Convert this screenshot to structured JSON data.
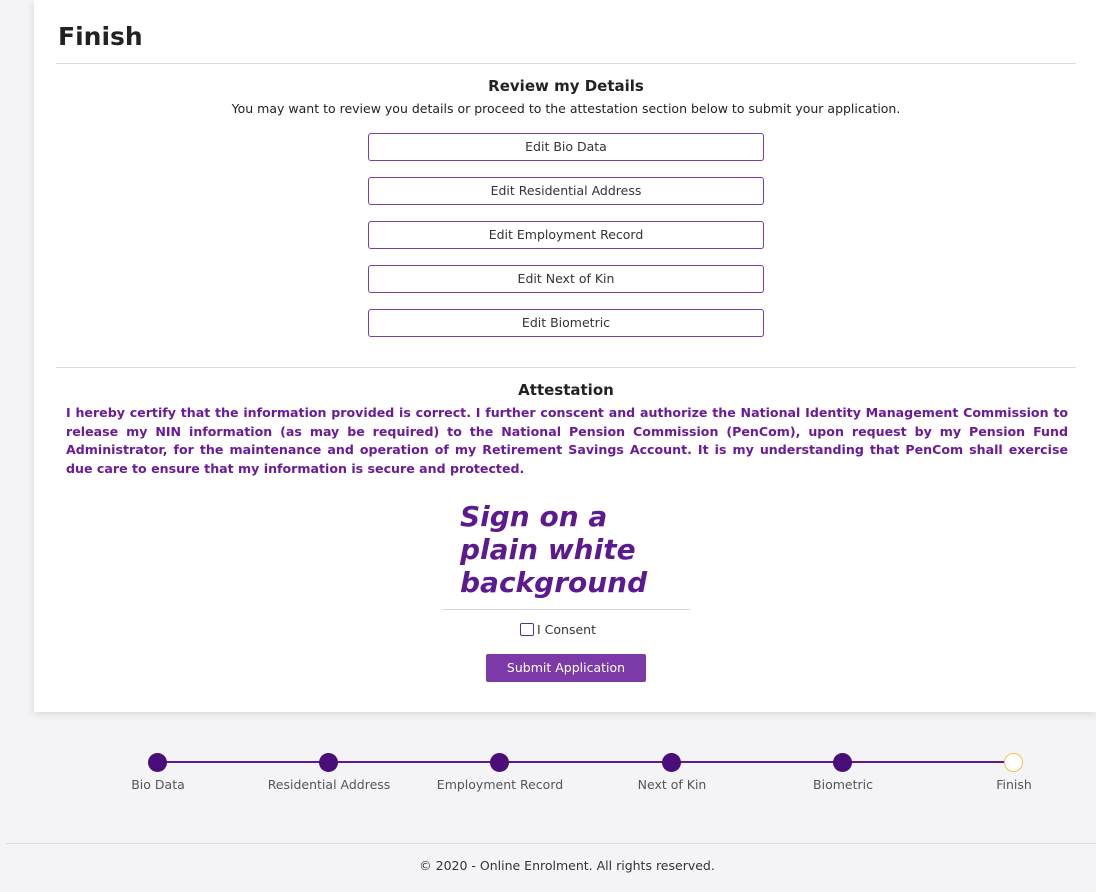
{
  "card": {
    "title": "Finish",
    "review": {
      "title": "Review my Details",
      "subtitle": "You may want to review you details or proceed to the attestation section below to submit your application.",
      "buttons": [
        {
          "label": "Edit Bio Data"
        },
        {
          "label": "Edit Residential Address"
        },
        {
          "label": "Edit Employment Record"
        },
        {
          "label": "Edit Next of Kin"
        },
        {
          "label": "Edit Biometric"
        }
      ]
    },
    "attestation": {
      "title": "Attestation",
      "text": "I hereby certify that the information provided is correct. I further conscent and authorize the National Identity Management Commission to release my NIN information (as may be required) to the National Pension Commission (PenCom), upon request by my Pension Fund Administrator, for the maintenance and operation of my Retirement Savings Account. It is my understanding that PenCom shall exercise due care to ensure that my information is secure and protected."
    },
    "signature": {
      "line1": "Sign on a",
      "line2": "plain white",
      "line3": "background"
    },
    "consent_label": "I Consent",
    "consent_checked": false,
    "submit_label": "Submit Application"
  },
  "stepper": {
    "steps": [
      {
        "label": "Bio Data",
        "status": "complete"
      },
      {
        "label": "Residential Address",
        "status": "complete"
      },
      {
        "label": "Employment Record",
        "status": "complete"
      },
      {
        "label": "Next of Kin",
        "status": "complete"
      },
      {
        "label": "Biometric",
        "status": "complete"
      },
      {
        "label": "Finish",
        "status": "current"
      }
    ]
  },
  "footer": {
    "text": "© 2020 - Online Enrolment. All rights reserved."
  },
  "colors": {
    "accent": "#7b3aa8",
    "step_complete": "#4a0e7a",
    "step_current_border": "#f2c14e",
    "attestation_text": "#6a1b9a"
  }
}
